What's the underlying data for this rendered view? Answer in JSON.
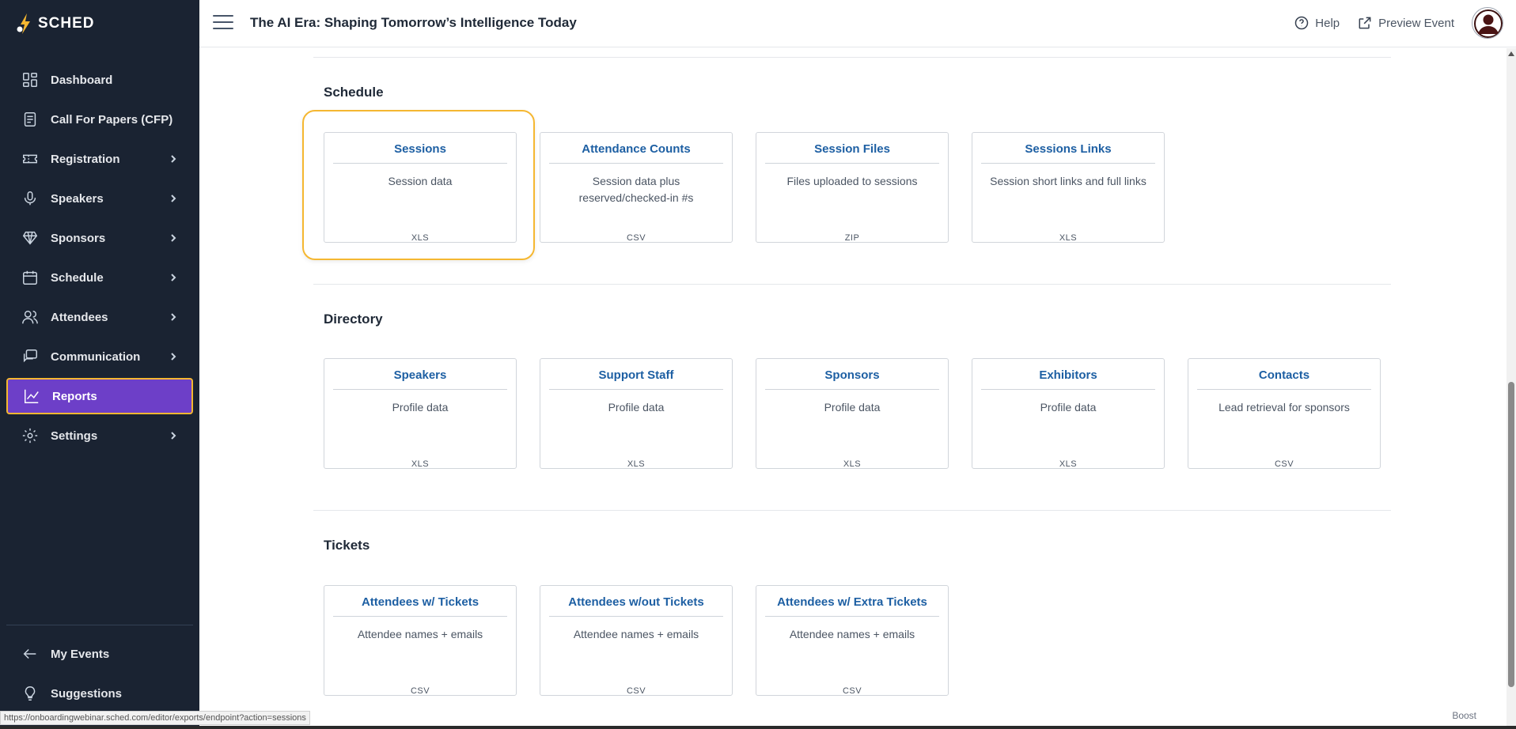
{
  "brand": {
    "name": "SCHED"
  },
  "event": {
    "title": "The AI Era: Shaping Tomorrow’s Intelligence Today"
  },
  "topbar": {
    "help_label": "Help",
    "preview_label": "Preview Event"
  },
  "sidebar": {
    "items": [
      {
        "label": "Dashboard",
        "icon": "dashboard-icon",
        "has_children": false
      },
      {
        "label": "Call For Papers (CFP)",
        "icon": "cfp-icon",
        "has_children": false
      },
      {
        "label": "Registration",
        "icon": "ticket-icon",
        "has_children": true
      },
      {
        "label": "Speakers",
        "icon": "microphone-icon",
        "has_children": true
      },
      {
        "label": "Sponsors",
        "icon": "diamond-icon",
        "has_children": true
      },
      {
        "label": "Schedule",
        "icon": "calendar-icon",
        "has_children": true
      },
      {
        "label": "Attendees",
        "icon": "people-icon",
        "has_children": true
      },
      {
        "label": "Communication",
        "icon": "chat-icon",
        "has_children": true
      },
      {
        "label": "Reports",
        "icon": "chart-icon",
        "has_children": false,
        "active": true
      },
      {
        "label": "Settings",
        "icon": "gear-icon",
        "has_children": true
      }
    ],
    "bottom": [
      {
        "label": "My Events",
        "icon": "arrow-left-icon"
      },
      {
        "label": "Suggestions",
        "icon": "lightbulb-icon"
      }
    ]
  },
  "sections": {
    "schedule": {
      "title": "Schedule",
      "cards": [
        {
          "title": "Sessions",
          "desc": "Session data",
          "format": "XLS"
        },
        {
          "title": "Attendance Counts",
          "desc": "Session data plus reserved/checked-in #s",
          "format": "CSV"
        },
        {
          "title": "Session Files",
          "desc": "Files uploaded to sessions",
          "format": "ZIP"
        },
        {
          "title": "Sessions Links",
          "desc": "Session short links and full links",
          "format": "XLS"
        }
      ]
    },
    "directory": {
      "title": "Directory",
      "cards": [
        {
          "title": "Speakers",
          "desc": "Profile data",
          "format": "XLS"
        },
        {
          "title": "Support Staff",
          "desc": "Profile data",
          "format": "XLS"
        },
        {
          "title": "Sponsors",
          "desc": "Profile data",
          "format": "XLS"
        },
        {
          "title": "Exhibitors",
          "desc": "Profile data",
          "format": "XLS"
        },
        {
          "title": "Contacts",
          "desc": "Lead retrieval for sponsors",
          "format": "CSV"
        }
      ]
    },
    "tickets": {
      "title": "Tickets",
      "cards": [
        {
          "title": "Attendees w/ Tickets",
          "desc": "Attendee names + emails",
          "format": "CSV"
        },
        {
          "title": "Attendees w/out Tickets",
          "desc": "Attendee names + emails",
          "format": "CSV"
        },
        {
          "title": "Attendees w/ Extra Tickets",
          "desc": "Attendee names + emails",
          "format": "CSV"
        }
      ]
    }
  },
  "status_url": "https://onboardingwebinar.sched.com/editor/exports/endpoint?action=sessions",
  "boost_label": "Boost",
  "colors": {
    "sidebar_bg": "#1a2332",
    "accent_purple": "#6d3fc8",
    "highlight_yellow": "#f5b731",
    "link_blue": "#1d5fa3"
  }
}
